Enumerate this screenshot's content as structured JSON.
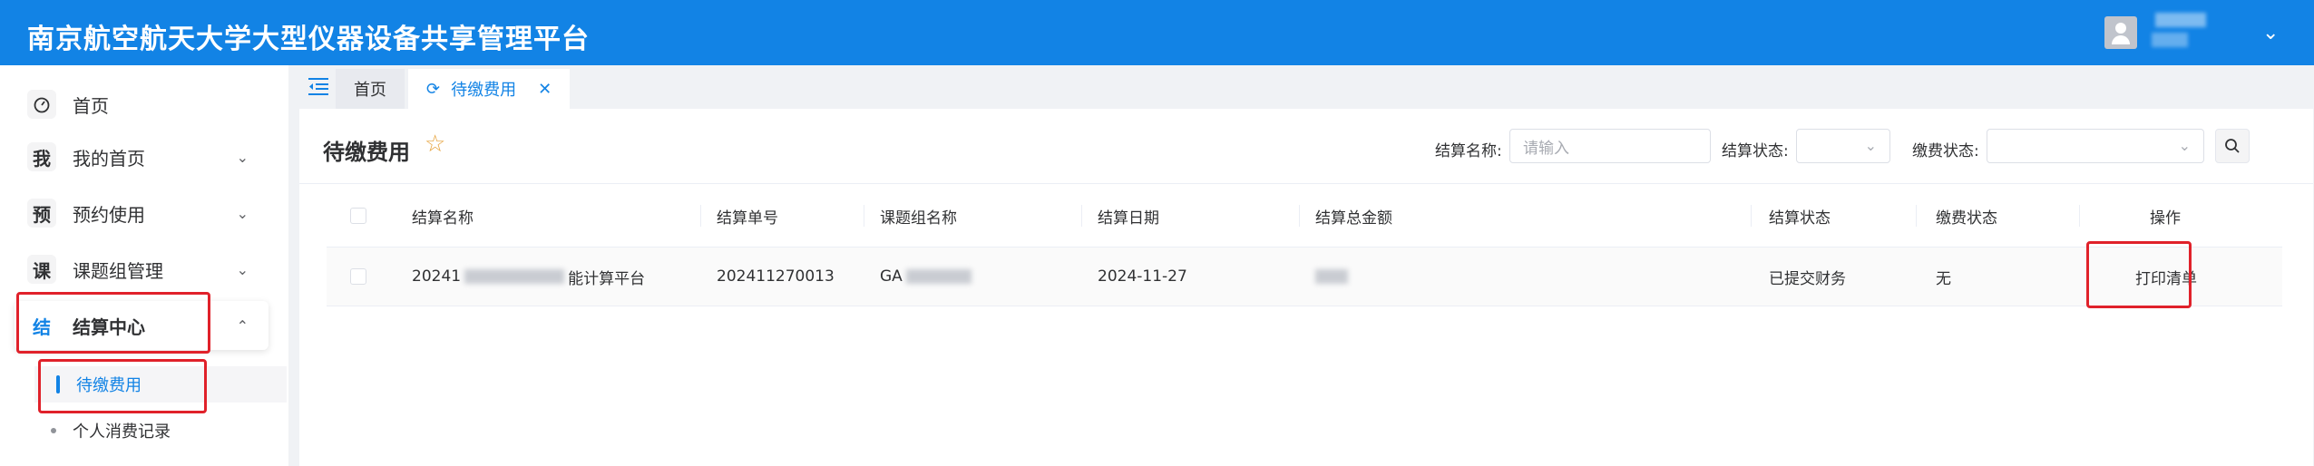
{
  "app": {
    "title": "南京航空航天大学大型仪器设备共享管理平台"
  },
  "sidebar": {
    "items": [
      {
        "badge": "",
        "label": "首页"
      },
      {
        "badge": "我",
        "label": "我的首页"
      },
      {
        "badge": "预",
        "label": "预约使用"
      },
      {
        "badge": "课",
        "label": "课题组管理"
      },
      {
        "badge": "结",
        "label": "结算中心"
      }
    ],
    "subitems": [
      {
        "label": "待缴费用"
      },
      {
        "label": "个人消费记录"
      }
    ]
  },
  "tabs": [
    {
      "label": "首页"
    },
    {
      "label": "待缴费用"
    }
  ],
  "page": {
    "title": "待缴费用",
    "filters": {
      "name_label": "结算名称:",
      "name_placeholder": "请输入",
      "status_label": "结算状态:",
      "pay_label": "缴费状态:"
    }
  },
  "table": {
    "headers": [
      "结算名称",
      "结算单号",
      "课题组名称",
      "结算日期",
      "结算总金额",
      "结算状态",
      "缴费状态",
      "操作"
    ],
    "rows": [
      {
        "name_prefix": "20241",
        "name_suffix": "能计算平台",
        "number": "202411270013",
        "group_prefix": "GA",
        "date": "2024-11-27",
        "status": "已提交财务",
        "pay_status": "无",
        "action": "打印清单"
      }
    ]
  },
  "colors": {
    "header_bg": "#1283e5",
    "accent": "#1283e5",
    "highlight_box": "#e0212a"
  }
}
